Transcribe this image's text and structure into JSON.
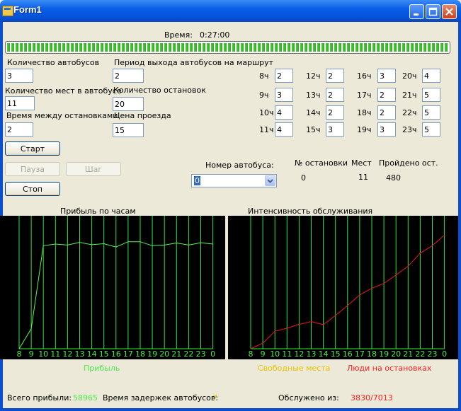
{
  "window": {
    "title": "Form1"
  },
  "time": {
    "label": "Время:",
    "value": "0:27:00",
    "progress": 1.0
  },
  "fields": {
    "bus_count": {
      "label": "Количество автобусов",
      "value": "3"
    },
    "seats": {
      "label": "Количество мест в автобусе",
      "value": "11"
    },
    "travel_time": {
      "label": "Время между остановками",
      "value": "2"
    },
    "period": {
      "label": "Период выхода автобусов на маршрут",
      "value": "2"
    },
    "stops": {
      "label": "Количество остановок",
      "value": "20"
    },
    "fare": {
      "label": "Цена проезда",
      "value": "15"
    }
  },
  "hours": [
    {
      "label": "8ч",
      "value": "2"
    },
    {
      "label": "9ч",
      "value": "3"
    },
    {
      "label": "10ч",
      "value": "4"
    },
    {
      "label": "11ч",
      "value": "4"
    },
    {
      "label": "12ч",
      "value": "2"
    },
    {
      "label": "13ч",
      "value": "2"
    },
    {
      "label": "14ч",
      "value": "2"
    },
    {
      "label": "15ч",
      "value": "3"
    },
    {
      "label": "16ч",
      "value": "3"
    },
    {
      "label": "17ч",
      "value": "2"
    },
    {
      "label": "18ч",
      "value": "2"
    },
    {
      "label": "19ч",
      "value": "3"
    },
    {
      "label": "20ч",
      "value": "4"
    },
    {
      "label": "21ч",
      "value": "5"
    },
    {
      "label": "22ч",
      "value": "5"
    },
    {
      "label": "23ч",
      "value": "5"
    }
  ],
  "buttons": {
    "start": "Старт",
    "pause": "Пауза",
    "step": "Шаг",
    "stop": "Стоп"
  },
  "bus_info": {
    "select_label": "Номер автобуса:",
    "selected": "0",
    "col_stop": "№ остановки",
    "col_seats": "Мест",
    "col_passed": "Пройдено ост.",
    "stop_value": "0",
    "seats_value": "11",
    "passed_value": "480"
  },
  "colors": {
    "grid": "#2ee82e",
    "profit": "#5cf25c",
    "people": "#e81a1a",
    "free": "#e8c000",
    "axis_label": "#4fe84f"
  },
  "chart_data": [
    {
      "type": "line",
      "title": "Прибыль по часам",
      "categories": [
        "8",
        "9",
        "10",
        "11",
        "12",
        "13",
        "14",
        "15",
        "16",
        "17",
        "18",
        "19",
        "20",
        "21",
        "22",
        "23",
        "0"
      ],
      "series": [
        {
          "name": "Прибыль",
          "values": [
            0,
            6,
            31,
            31.5,
            31.2,
            32,
            31.3,
            31.6,
            30.6,
            32.2,
            32.2,
            31,
            31.2,
            31.8,
            31.2,
            31.9,
            31.5
          ]
        }
      ],
      "ylim": [
        0,
        40
      ]
    },
    {
      "type": "line",
      "title": "Интенсивность обслуживания",
      "categories": [
        "8",
        "9",
        "10",
        "11",
        "12",
        "13",
        "14",
        "15",
        "16",
        "17",
        "18",
        "19",
        "20",
        "21",
        "22",
        "23",
        "0"
      ],
      "series": [
        {
          "name": "Свободные места",
          "values": []
        },
        {
          "name": "Люди на остановках",
          "values": [
            0,
            2,
            6.3,
            7.4,
            8.8,
            9.8,
            8.7,
            12,
            15.6,
            19.4,
            21.8,
            23.6,
            26.6,
            29.8,
            34.5,
            37.2,
            41
          ]
        }
      ],
      "ylim": [
        0,
        48
      ]
    }
  ],
  "summary": {
    "profit_label": "Всего прибыли:",
    "profit_value": "58965",
    "delay_label": "Время задержек автобусов:",
    "delay_value": "7",
    "served_label": "Обслужено из:",
    "served_value": "3830/7013"
  }
}
